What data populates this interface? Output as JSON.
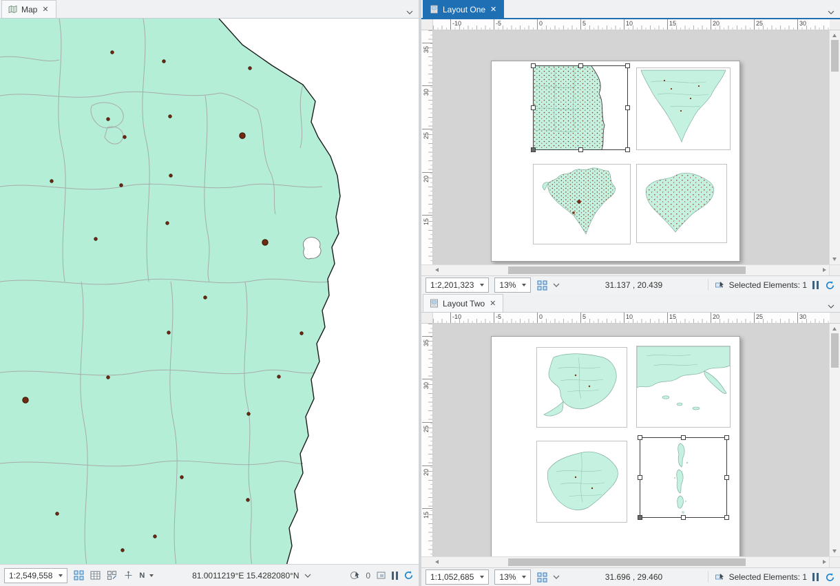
{
  "icons": {
    "close": "✕",
    "north": "N"
  },
  "colors": {
    "map_fill": "#b5eed6",
    "layout_map_fill": "#c4f1e0",
    "active_tab": "#1f6fb5",
    "accent_blue": "#1f86c9",
    "dot_color": "#6f2b12"
  },
  "rulers": {
    "h": [
      "-10",
      "-5",
      "0",
      "5",
      "10",
      "15",
      "20",
      "25",
      "30"
    ],
    "v": [
      "35",
      "30",
      "25",
      "20",
      "15"
    ]
  },
  "map_pane": {
    "tab_label": "Map",
    "status": {
      "scale": "1:2,549,558",
      "coordinates": "81.0011219°E 15.4282080°N",
      "count": "0"
    }
  },
  "layout_one": {
    "tab_label": "Layout One",
    "status": {
      "scale": "1:2,201,323",
      "zoom": "13%",
      "coordinates": "31.137 , 20.439",
      "selected_elements": "Selected Elements: 1"
    }
  },
  "layout_two": {
    "tab_label": "Layout Two",
    "status": {
      "scale": "1:1,052,685",
      "zoom": "13%",
      "coordinates": "31.696 , 29.460",
      "selected_elements": "Selected Elements: 1"
    }
  }
}
